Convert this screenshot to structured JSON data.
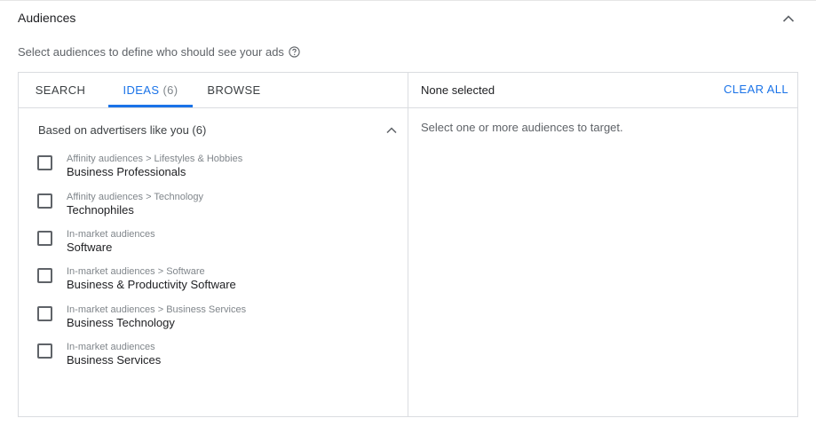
{
  "section": {
    "title": "Audiences",
    "subtitle": "Select audiences to define who should see your ads",
    "icons": {
      "collapse": "chevron-up-icon",
      "help": "help-circle-icon"
    }
  },
  "tabs": [
    {
      "label": "SEARCH"
    },
    {
      "label": "IDEAS",
      "count": "(6)",
      "active": true
    },
    {
      "label": "BROWSE"
    }
  ],
  "group": {
    "label": "Based on advertisers like you (6)",
    "icon": "chevron-up-icon"
  },
  "items": [
    {
      "path": "Affinity audiences > Lifestyles & Hobbies",
      "name": "Business Professionals",
      "checked": false
    },
    {
      "path": "Affinity audiences > Technology",
      "name": "Technophiles",
      "checked": false
    },
    {
      "path": "In-market audiences",
      "name": "Software",
      "checked": false
    },
    {
      "path": "In-market audiences > Software",
      "name": "Business & Productivity Software",
      "checked": false
    },
    {
      "path": "In-market audiences > Business Services",
      "name": "Business Technology",
      "checked": false
    },
    {
      "path": "In-market audiences",
      "name": "Business Services",
      "checked": false
    }
  ],
  "selection": {
    "status": "None selected",
    "clear_label": "CLEAR ALL",
    "empty_message": "Select one or more audiences to target."
  },
  "colors": {
    "accent": "#1a73e8",
    "border": "#dadce0",
    "muted_text": "#80868b"
  }
}
